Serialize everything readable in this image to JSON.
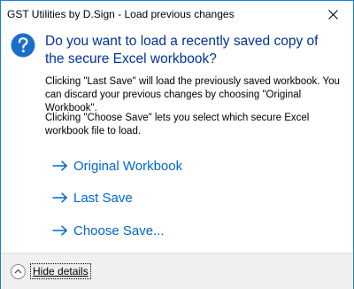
{
  "window": {
    "title": "GST Utilities by D.Sign - Load previous changes",
    "close_icon": "close-icon"
  },
  "dialog": {
    "icon": "question-icon",
    "accent_color": "#1883d7",
    "main_instruction": "Do you want to load a recently saved copy of the secure Excel workbook?",
    "description_1": "Clicking \"Last Save\" will load the previously saved workbook. You can discard your previous changes by choosing \"Original Workbook\".",
    "description_2": "Clicking \"Choose Save\" lets you select which secure Excel workbook file to load.",
    "command_links": [
      {
        "label": "Original Workbook",
        "icon": "arrow-right-icon"
      },
      {
        "label": "Last Save",
        "icon": "arrow-right-icon"
      },
      {
        "label": "Choose Save...",
        "icon": "arrow-right-icon"
      }
    ]
  },
  "footer": {
    "details_toggle_label": "Hide details",
    "details_toggle_icon": "chevron-up-icon"
  }
}
